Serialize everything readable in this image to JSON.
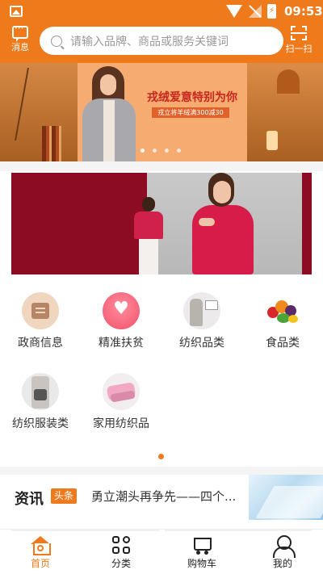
{
  "status_bar": {
    "time": "09:53",
    "battery_glyph": "⚡"
  },
  "header": {
    "message_label": "消息",
    "scan_label": "扫一扫",
    "search_placeholder": "请输入品牌、商品或服务关键词"
  },
  "banner": {
    "title": "戎绒爱意特别为你",
    "subtitle": "戎立将羊绒满300减30",
    "dot_count": 4,
    "active_dot": 1
  },
  "categories": [
    {
      "label": "政商信息",
      "icon": "document-icon"
    },
    {
      "label": "精准扶贫",
      "icon": "heart-icon"
    },
    {
      "label": "纺织品类",
      "icon": "textile-icon"
    },
    {
      "label": "食品类",
      "icon": "food-icon"
    },
    {
      "label": "纺织服装类",
      "icon": "clothing-icon"
    },
    {
      "label": "家用纺织品",
      "icon": "home-textile-icon"
    }
  ],
  "news": {
    "brand": "资讯",
    "tag": "头条",
    "headline": "勇立潮头再争先——四个..."
  },
  "tabbar": [
    {
      "label": "首页",
      "icon": "home-icon",
      "active": true
    },
    {
      "label": "分类",
      "icon": "category-icon",
      "active": false
    },
    {
      "label": "购物车",
      "icon": "cart-icon",
      "active": false
    },
    {
      "label": "我的",
      "icon": "user-icon",
      "active": false
    }
  ],
  "colors": {
    "accent": "#ee7a1c",
    "promo_bg": "#8c0c24"
  }
}
